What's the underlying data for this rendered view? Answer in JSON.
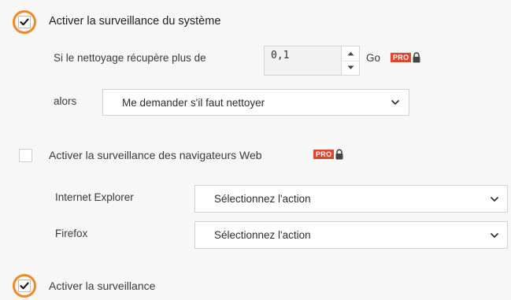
{
  "system": {
    "enable_label": "Activer la surveillance du système",
    "checked": true,
    "cleanup_prefix": "Si le nettoyage récupère plus de",
    "threshold_value": "0,1",
    "unit": "Go",
    "then_label": "alors",
    "action_value": "Me demander s'il faut nettoyer"
  },
  "browsers": {
    "enable_label": "Activer la surveillance des navigateurs Web",
    "checked": false,
    "items": [
      {
        "label": "Internet Explorer",
        "action": "Sélectionnez l'action"
      },
      {
        "label": "Firefox",
        "action": "Sélectionnez l'action"
      }
    ]
  },
  "third": {
    "enable_label": "Activer la surveillance",
    "checked": true
  },
  "badge": {
    "text": "PRO",
    "color": "#e2452e"
  },
  "icons": [
    "checkmark-icon",
    "lock-icon",
    "chevron-up-icon",
    "chevron-down-icon"
  ],
  "colors": {
    "highlight_ring": "#f08a24",
    "background": "#f7f7f7"
  }
}
